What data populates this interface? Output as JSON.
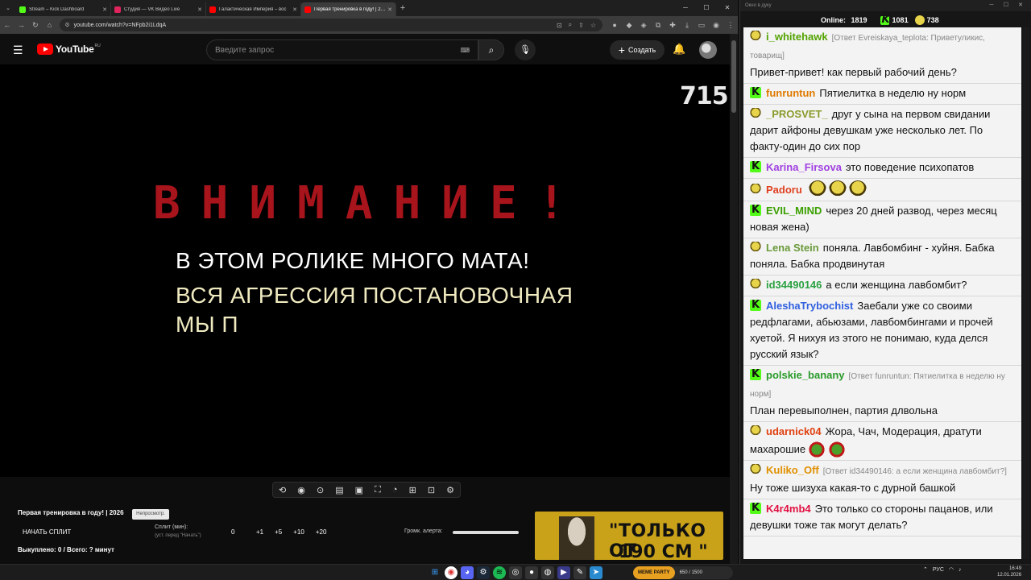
{
  "browser": {
    "tabs": [
      {
        "title": "Stream – Kick Dashboard",
        "favicon_color": "#53fc18"
      },
      {
        "title": "Студия — VK Видео Live",
        "favicon_color": "#e0245e"
      },
      {
        "title": "Галактическая Империя – вос",
        "favicon_color": "#ff0000"
      },
      {
        "title": "Первая тренировка в году! | 2…",
        "favicon_color": "#ff0000",
        "active": true
      }
    ],
    "url": "youtube.com/watch?v=NFpb2i1LdqA"
  },
  "youtube": {
    "logo_text": "YouTube",
    "region": "RU",
    "search_placeholder": "Введите запрос",
    "create_label": "Создать"
  },
  "video": {
    "counter": "715",
    "warning": "ВНИМАНИЕ!",
    "line1": "В ЭТОМ РОЛИКЕ  МНОГО МАТА!",
    "line2": "ВСЯ АГРЕССИЯ ПОСТАНОВОЧНАЯ",
    "line3": "МЫ П"
  },
  "panel": {
    "title": "Первая тренировка в году! | 2026",
    "badge": "Непросмотр.",
    "start_split": "НАЧАТЬ СПЛИТ",
    "split_label": "Сплит (мин):",
    "split_hint": "(уст. перед \"Начать\")",
    "split_value": "0",
    "split_buttons": [
      "+1",
      "+5",
      "+10",
      "+20"
    ],
    "alert_label": "Громк. алерта:",
    "bought": "Выкуплено: 0 / Всего: ? минут",
    "promo_line1": "\"ТОЛЬКО ОТ",
    "promo_line2": "190 СМ \""
  },
  "chat": {
    "window_title": "Окно в дуку",
    "online_label": "Online:",
    "online_count": "1819",
    "kick_count": "1081",
    "other_count": "738",
    "messages": [
      {
        "platform": "p",
        "nick": "i_whitehawk",
        "color": "#53a300",
        "reply": "[Ответ Evreiskaya_teplota: Приветуликис, товарищ]",
        "text": "Привет-привет! как первый рабочий день?"
      },
      {
        "platform": "k",
        "nick": "funruntun",
        "color": "#e07a00",
        "reply": "",
        "text": "Пятиелитка в неделю ну норм"
      },
      {
        "platform": "p",
        "nick": "_PROSVET_",
        "color": "#8a9a2a",
        "reply": "",
        "text": "друг у сына на первом свидании дарит айфоны девушкам уже несколько лет. По факту-один до сих пор"
      },
      {
        "platform": "k",
        "nick": "Karina_Firsova",
        "color": "#a040e0",
        "reply": "",
        "text": "это поведение психопатов"
      },
      {
        "platform": "p",
        "nick": "Padoru",
        "color": "#e04020",
        "reply": "",
        "text": "",
        "emotes": 3
      },
      {
        "platform": "k",
        "nick": "EVIL_MIND",
        "color": "#3aa000",
        "reply": "",
        "text": "через 20 дней развод, через месяц новая жена)"
      },
      {
        "platform": "p",
        "nick": "Lena Stein",
        "color": "#6a9a3a",
        "reply": "",
        "text": "поняла. Лавбомбинг - хуйня. Бабка поняла. Бабка продвинутая"
      },
      {
        "platform": "p",
        "nick": "id34490146",
        "color": "#2aa040",
        "reply": "",
        "text": "а если женщина лавбомбит?"
      },
      {
        "platform": "k",
        "nick": "AleshaTrybochist",
        "color": "#3060e0",
        "reply": "",
        "text": "Заебали уже со своими редфлагами, абьюзами, лавбомбингами и прочей хуетой. Я нихуя из этого не понимаю, куда делся русский язык?"
      },
      {
        "platform": "k",
        "nick": "polskie_banany",
        "color": "#2a9a2a",
        "reply": "[Ответ funruntun: Пятиелитка в неделю ну норм]",
        "text": "План перевыполнен, партия длвольна"
      },
      {
        "platform": "p",
        "nick": "udarnick04",
        "color": "#e04010",
        "reply": "",
        "text": "Жора, Чач, Модерация, дратути махарошие",
        "emotes_red": 2
      },
      {
        "platform": "p",
        "nick": "Kuliko_Off",
        "color": "#e09000",
        "reply": "[Ответ id34490146: а если женщина лавбомбит?]",
        "text": "Ну тоже шизуха какая-то с дурной башкой"
      },
      {
        "platform": "k",
        "nick": "K4r4mb4",
        "color": "#e01040",
        "reply": "",
        "text": "Это только со стороны пацанов, или девушки тоже так могут делать?"
      }
    ]
  },
  "taskbar": {
    "widget_label": "MEME PARTY",
    "widget_value": "650 / 1500",
    "lang": "РУС",
    "time": "16:49",
    "date": "12.01.2026"
  }
}
